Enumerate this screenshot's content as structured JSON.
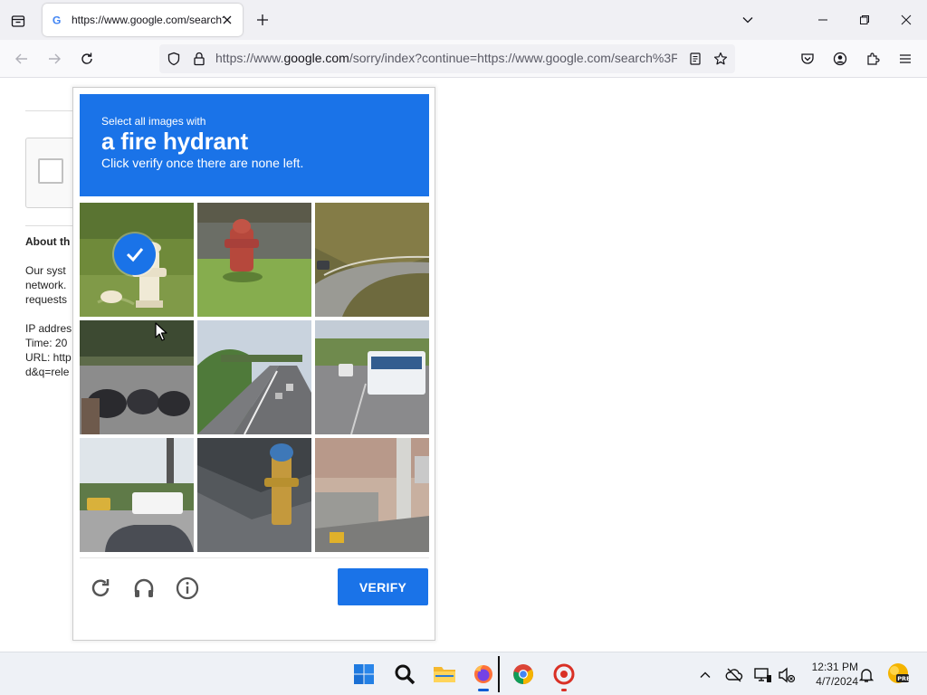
{
  "browser": {
    "tab": {
      "title": "https://www.google.com/search?q=release"
    },
    "url": {
      "prefix": "https://www.",
      "domain": "google.com",
      "path": "/sorry/index?continue=https://www.google.com/search%3F"
    }
  },
  "background_page": {
    "heading": "About th",
    "lines": [
      "Our syst",
      "network.",
      "requests"
    ],
    "ip": "IP addres",
    "time": "Time: 20",
    "url": "URL: http",
    "url2": "d&q=rele"
  },
  "captcha": {
    "header_small": "Select all images with",
    "header_big": "a fire hydrant",
    "header_sub": "Click verify once there are none left.",
    "verify_label": "VERIFY",
    "tiles": [
      {
        "content": "white fire hydrant on grass",
        "selected": true
      },
      {
        "content": "red fire hydrant on grass",
        "selected": false
      },
      {
        "content": "winding road on hillside",
        "selected": false
      },
      {
        "content": "parked motorcycles",
        "selected": false
      },
      {
        "content": "highway with overpass",
        "selected": false
      },
      {
        "content": "road with white bus",
        "selected": false
      },
      {
        "content": "parking lot with cars",
        "selected": false
      },
      {
        "content": "yellow fire hydrant near curb",
        "selected": false
      },
      {
        "content": "building corner with pole",
        "selected": false
      }
    ]
  },
  "taskbar": {
    "time": "12:31 PM",
    "date": "4/7/2024",
    "apps": [
      "start",
      "search",
      "file-explorer",
      "firefox",
      "chrome",
      "app"
    ]
  },
  "colors": {
    "accent": "#1a73e8",
    "tab_bg": "#f0f0f4"
  }
}
